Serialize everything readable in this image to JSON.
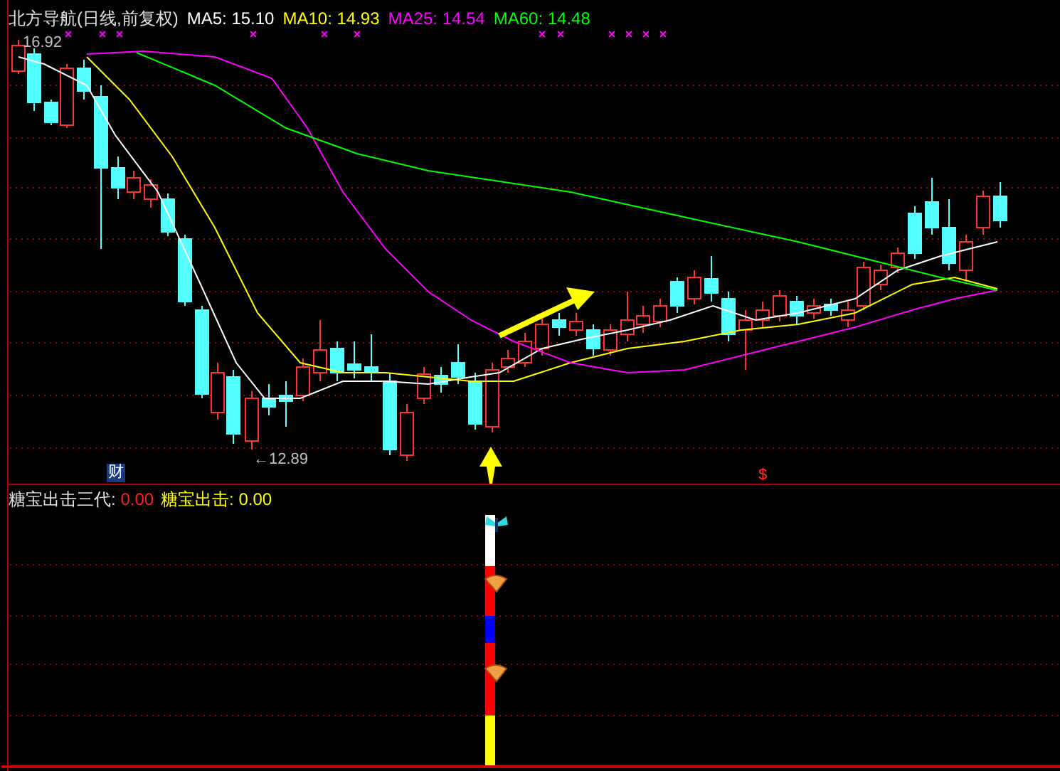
{
  "header": {
    "title": "北方导航(日线,前复权)",
    "averages": [
      {
        "label": "MA5:",
        "value": "15.10",
        "color": "#ffffff"
      },
      {
        "label": "MA10:",
        "value": "14.93",
        "color": "#ffff00"
      },
      {
        "label": "MA25:",
        "value": "14.54",
        "color": "#ff00ff"
      },
      {
        "label": "MA60:",
        "value": "14.48",
        "color": "#00ff00"
      }
    ]
  },
  "price_labels": {
    "high": "16.92",
    "low": "←12.89"
  },
  "badge": "财",
  "marker": "$",
  "indicator": {
    "name": "糖宝出击三代",
    "separator": ":",
    "value": "0.00",
    "signal_label": "糖宝出击:",
    "signal_value": "0.00"
  }
}
